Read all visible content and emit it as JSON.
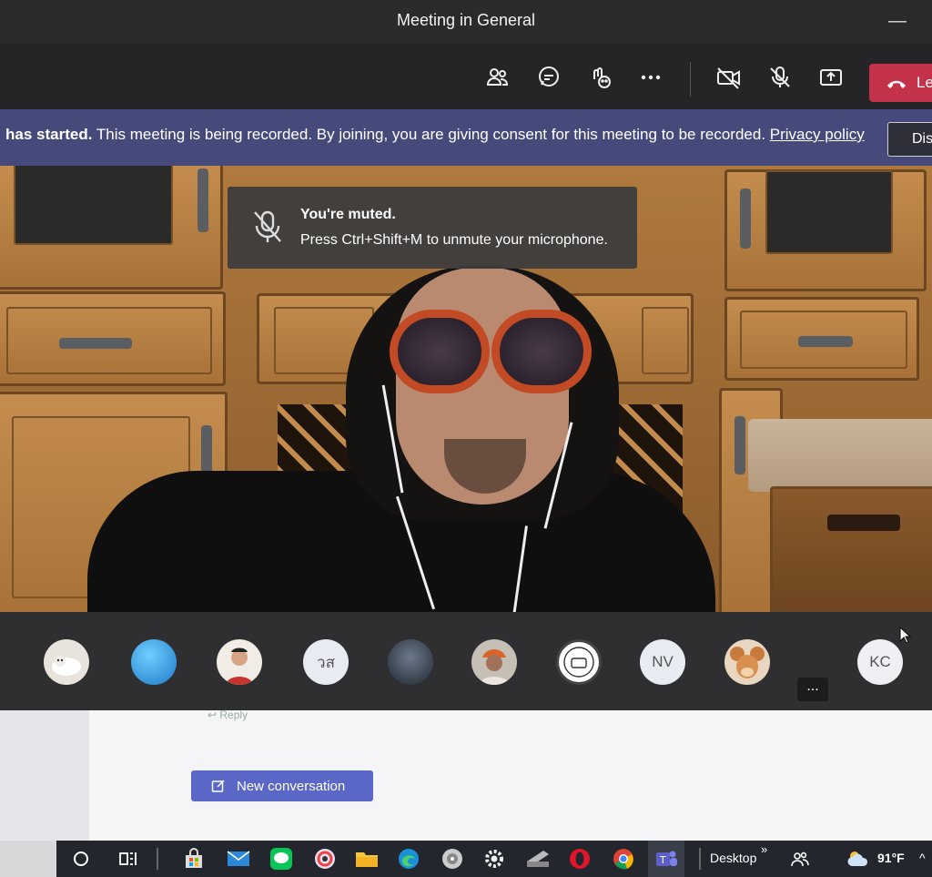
{
  "window": {
    "title": "Meeting in General"
  },
  "toolbar": {
    "leave_label": "Le",
    "buttons": [
      "participants-icon",
      "chat-icon",
      "reactions-icon",
      "more-icon",
      "camera-off-icon",
      "mic-off-icon",
      "share-icon"
    ]
  },
  "banner": {
    "bold_text": "has started.",
    "message": "This meeting is being recorded. By joining, you are giving consent for this meeting to be recorded.",
    "link_text": "Privacy policy",
    "dismiss_label": "Dis"
  },
  "toast": {
    "title": "You're muted.",
    "body": "Press Ctrl+Shift+M to unmute your microphone."
  },
  "participants": {
    "initials_1": "วส",
    "initials_2": "NV",
    "initials_3": "KC",
    "more_label": "..."
  },
  "panel": {
    "reply_label": "Reply",
    "new_conversation_label": "New conversation"
  },
  "taskbar": {
    "desktop_label": "Desktop",
    "chevron": "»",
    "weather": "91°F"
  },
  "colors": {
    "banner_bg": "#464a7a",
    "leave_red": "#c4314b",
    "accent": "#5b67c7"
  }
}
